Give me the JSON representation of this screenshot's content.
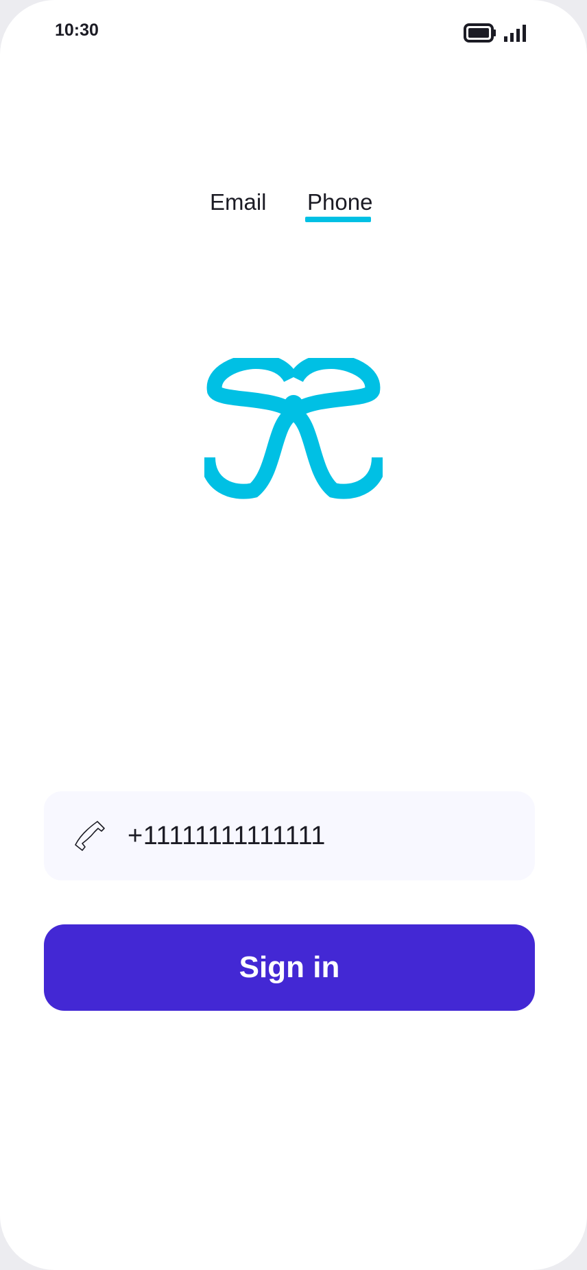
{
  "status_bar": {
    "time": "10:30",
    "icons": [
      "battery-icon",
      "signal-icon"
    ]
  },
  "tabs": [
    {
      "label": "Email",
      "selected": false
    },
    {
      "label": "Phone",
      "selected": true
    }
  ],
  "logo": {
    "icon": "app-logo"
  },
  "phone_input": {
    "icon": "phone-icon",
    "value": "+11111111111111",
    "placeholder": ""
  },
  "signin": {
    "label": "Sign in"
  },
  "colors": {
    "accent": "#00c0e4",
    "primary_button": "#4328d4",
    "input_background": "#f8f8ff",
    "text": "#1b1b24"
  }
}
